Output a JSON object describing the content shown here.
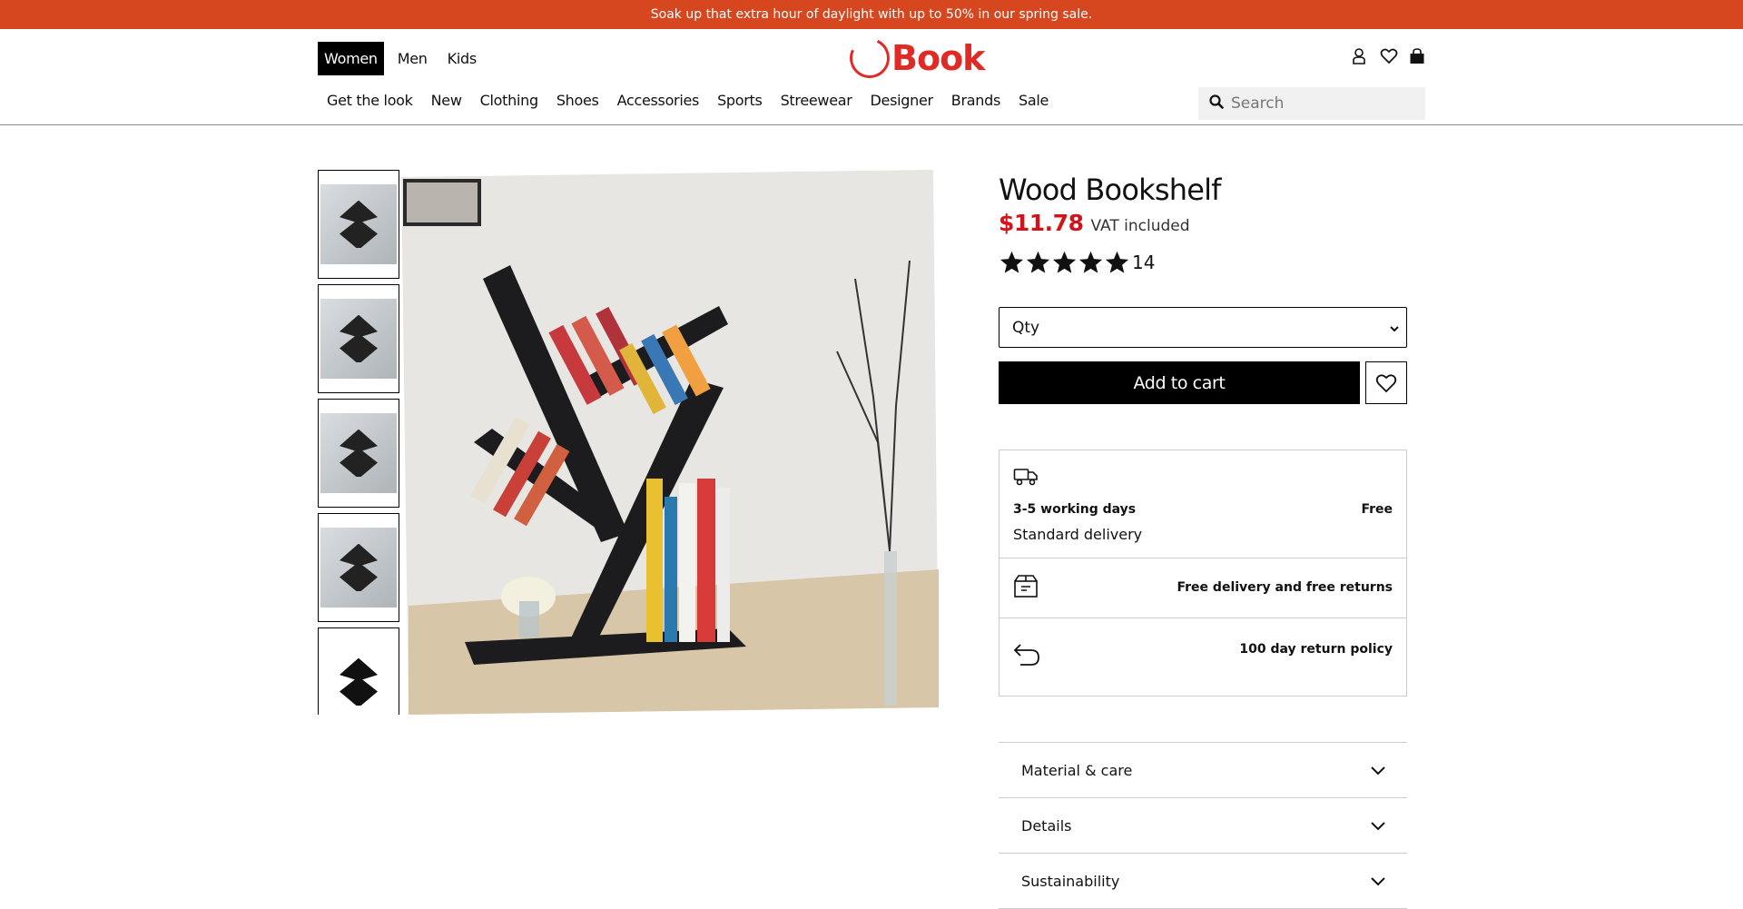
{
  "promo": {
    "text": "Soak up that extra hour of daylight with up to 50% in our spring sale."
  },
  "header": {
    "gender_tabs": [
      {
        "label": "Women",
        "active": true
      },
      {
        "label": "Men",
        "active": false
      },
      {
        "label": "Kids",
        "active": false
      }
    ],
    "logo_text": "Book",
    "brand_color": "#e02a25",
    "icons": [
      "user-icon",
      "heart-icon",
      "bag-icon"
    ]
  },
  "nav": {
    "items": [
      "Get the look",
      "New",
      "Clothing",
      "Shoes",
      "Accessories",
      "Sports",
      "Streewear",
      "Designer",
      "Brands",
      "Sale"
    ],
    "search_placeholder": "Search"
  },
  "product": {
    "title": "Wood Bookshelf",
    "price": "$11.78",
    "price_color": "#d0141b",
    "vat": "VAT included",
    "rating_stars": 5,
    "rating_count": "14",
    "qty_placeholder": "Qty",
    "add_to_cart": "Add to cart",
    "thumbnails": 5
  },
  "delivery": {
    "days": "3-5 working days",
    "standard": "Standard delivery",
    "cost": "Free",
    "free_returns": "Free delivery and free returns",
    "return_policy": "100 day return policy"
  },
  "accordion": [
    "Material & care",
    "Details",
    "Sustainability"
  ]
}
